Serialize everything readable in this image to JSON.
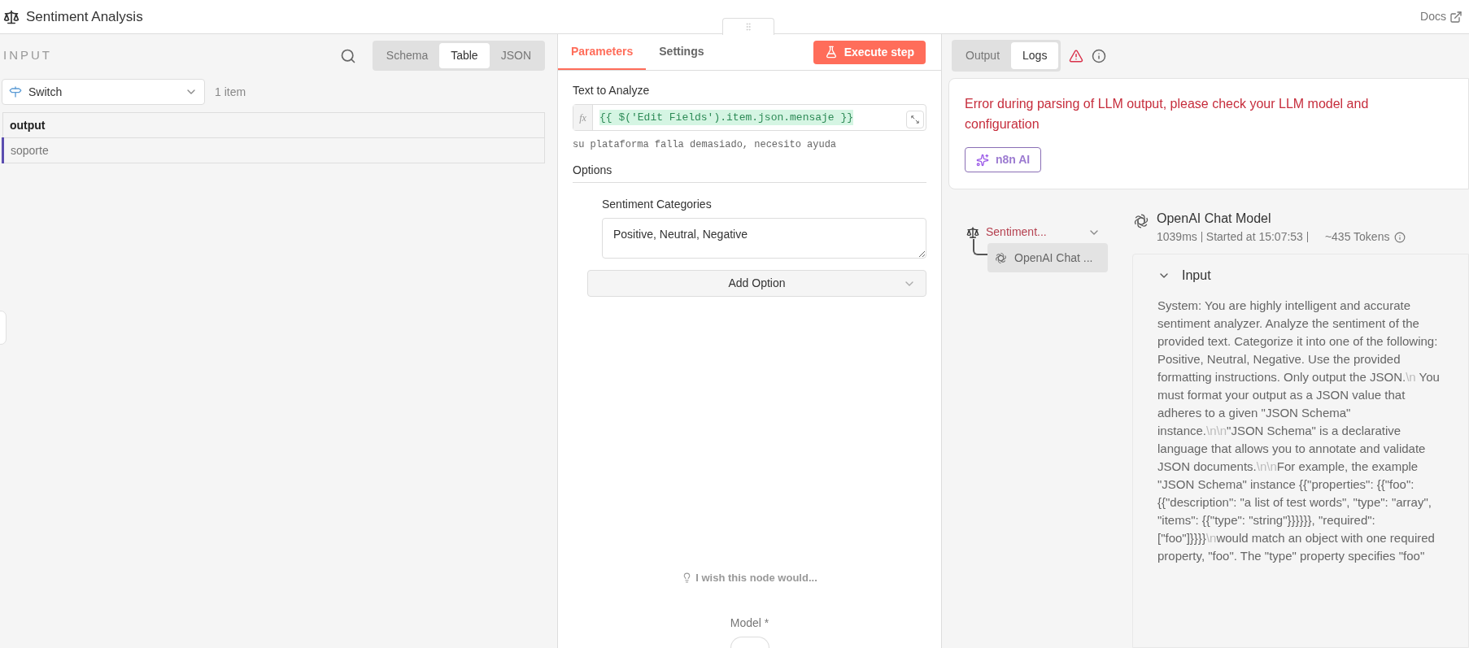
{
  "header": {
    "title": "Sentiment Analysis",
    "docs_link": "Docs"
  },
  "input_panel": {
    "title": "INPUT",
    "view_tabs": [
      {
        "label": "Schema",
        "selected": false
      },
      {
        "label": "Table",
        "selected": true
      },
      {
        "label": "JSON",
        "selected": false
      }
    ],
    "node_select": {
      "value": "Switch"
    },
    "item_count": "1 item",
    "table": {
      "columns": [
        "output"
      ],
      "rows": [
        {
          "cells": [
            "soporte"
          ],
          "selected": true
        }
      ]
    }
  },
  "parameters_panel": {
    "tabs": [
      {
        "label": "Parameters",
        "selected": true
      },
      {
        "label": "Settings",
        "selected": false
      }
    ],
    "execute_button": "Execute step",
    "text_to_analyze": {
      "label": "Text to Analyze",
      "fx": "fx",
      "expression": "{{ $('Edit Fields').item.json.mensaje }}",
      "result": "su plataforma falla demasiado, necesito ayuda"
    },
    "options_title": "Options",
    "sentiment_categories": {
      "label": "Sentiment Categories",
      "value": "Positive, Neutral, Negative"
    },
    "add_option": "Add Option",
    "feedback": "I wish this node would...",
    "model_label": "Model *"
  },
  "output_panel": {
    "tabs": [
      {
        "label": "Output",
        "selected": false
      },
      {
        "label": "Logs",
        "selected": true
      }
    ],
    "error": {
      "message": "Error during parsing of LLM output, please check your LLM model and configuration",
      "ai_button": "n8n AI"
    },
    "tree": [
      {
        "label": "Sentiment...",
        "error": true,
        "expanded": true,
        "children": [
          {
            "label": "OpenAI Chat ...",
            "selected": true
          }
        ]
      }
    ],
    "detail": {
      "title": "OpenAI Chat Model",
      "duration": "1039ms",
      "started": "Started at 15:07:53",
      "tokens": "~435 Tokens",
      "input": {
        "title": "Input",
        "expanded": true,
        "segments": [
          {
            "kind": "text",
            "text": "System: You are highly intelligent and accurate sentiment analyzer. Analyze the sentiment of the provided text. Categorize it into one of the following: Positive, Neutral, Negative. Use the provided formatting instructions. Only output the JSON."
          },
          {
            "kind": "escape",
            "text": "\\n"
          },
          {
            "kind": "text",
            "text": " You must format your output as a JSON value that adheres to a given \"JSON Schema\" instance."
          },
          {
            "kind": "escape",
            "text": "\\n"
          },
          {
            "kind": "escape",
            "text": "\\n"
          },
          {
            "kind": "text",
            "text": "\"JSON Schema\" is a declarative language that allows you to annotate and validate JSON documents."
          },
          {
            "kind": "escape",
            "text": "\\n"
          },
          {
            "kind": "escape",
            "text": "\\n"
          },
          {
            "kind": "text",
            "text": "For example, the example \"JSON Schema\" instance {{\"properties\": {{\"foo\": {{\"description\": \"a list of test words\", \"type\": \"array\", \"items\": {{\"type\": \"string\"}}}}}}, \"required\": [\"foo\"]}}}}"
          },
          {
            "kind": "escape",
            "text": "\\n"
          },
          {
            "kind": "text",
            "text": "would match an object with one required property, \"foo\". The \"type\" property specifies \"foo\""
          }
        ]
      }
    }
  }
}
